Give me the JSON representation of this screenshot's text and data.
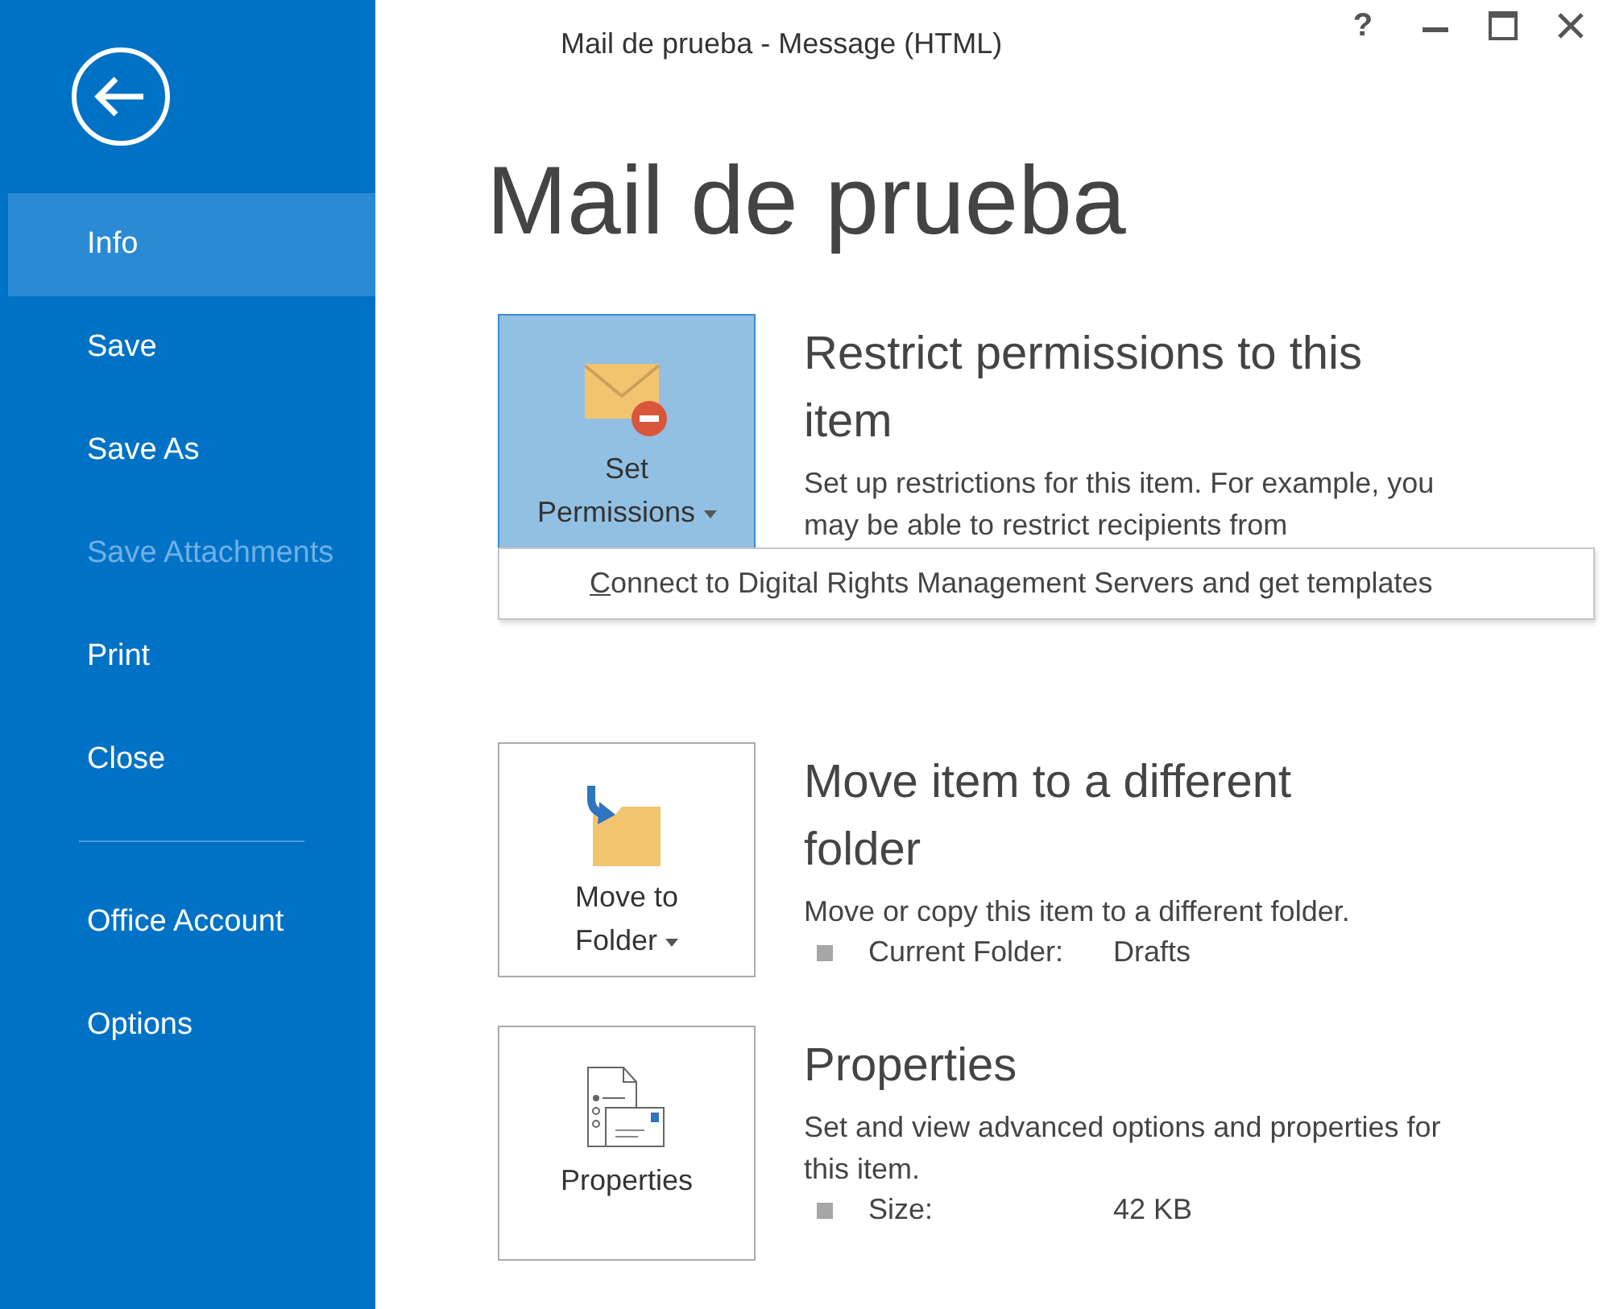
{
  "window": {
    "title": "Mail de prueba - Message (HTML)",
    "help": "?"
  },
  "sidebar": {
    "items": [
      {
        "label": "Info",
        "selected": true,
        "disabled": false
      },
      {
        "label": "Save",
        "selected": false,
        "disabled": false
      },
      {
        "label": "Save As",
        "selected": false,
        "disabled": false
      },
      {
        "label": "Save Attachments",
        "selected": false,
        "disabled": true
      },
      {
        "label": "Print",
        "selected": false,
        "disabled": false
      },
      {
        "label": "Close",
        "selected": false,
        "disabled": false
      }
    ],
    "footer_items": [
      {
        "label": "Office Account",
        "selected": false,
        "disabled": false
      },
      {
        "label": "Options",
        "selected": false,
        "disabled": false
      }
    ]
  },
  "page_title": "Mail de prueba",
  "sections": [
    {
      "kind": "permissions",
      "button": {
        "label": "Set Permissions",
        "has_menu": true,
        "selected": true
      },
      "heading": "Restrict permissions to this item",
      "description": "Set up restrictions for this item. For example, you may be able to restrict recipients from",
      "menu": {
        "items": [
          {
            "label": "Connect to Digital Rights Management Servers and get templates",
            "access_key_underlined": true
          }
        ]
      }
    },
    {
      "kind": "folder",
      "button": {
        "label": "Move to Folder",
        "has_menu": true,
        "selected": false
      },
      "heading": "Move item to a different folder",
      "description": "Move or copy this item to a different folder.",
      "details": [
        {
          "label": "Current Folder:",
          "value": "Drafts"
        }
      ]
    },
    {
      "kind": "properties",
      "button": {
        "label": "Properties",
        "has_menu": false,
        "selected": false
      },
      "heading": "Properties",
      "description": "Set and view advanced options and properties for this item.",
      "details": [
        {
          "label": "Size:",
          "value": "42 KB"
        }
      ]
    }
  ]
}
